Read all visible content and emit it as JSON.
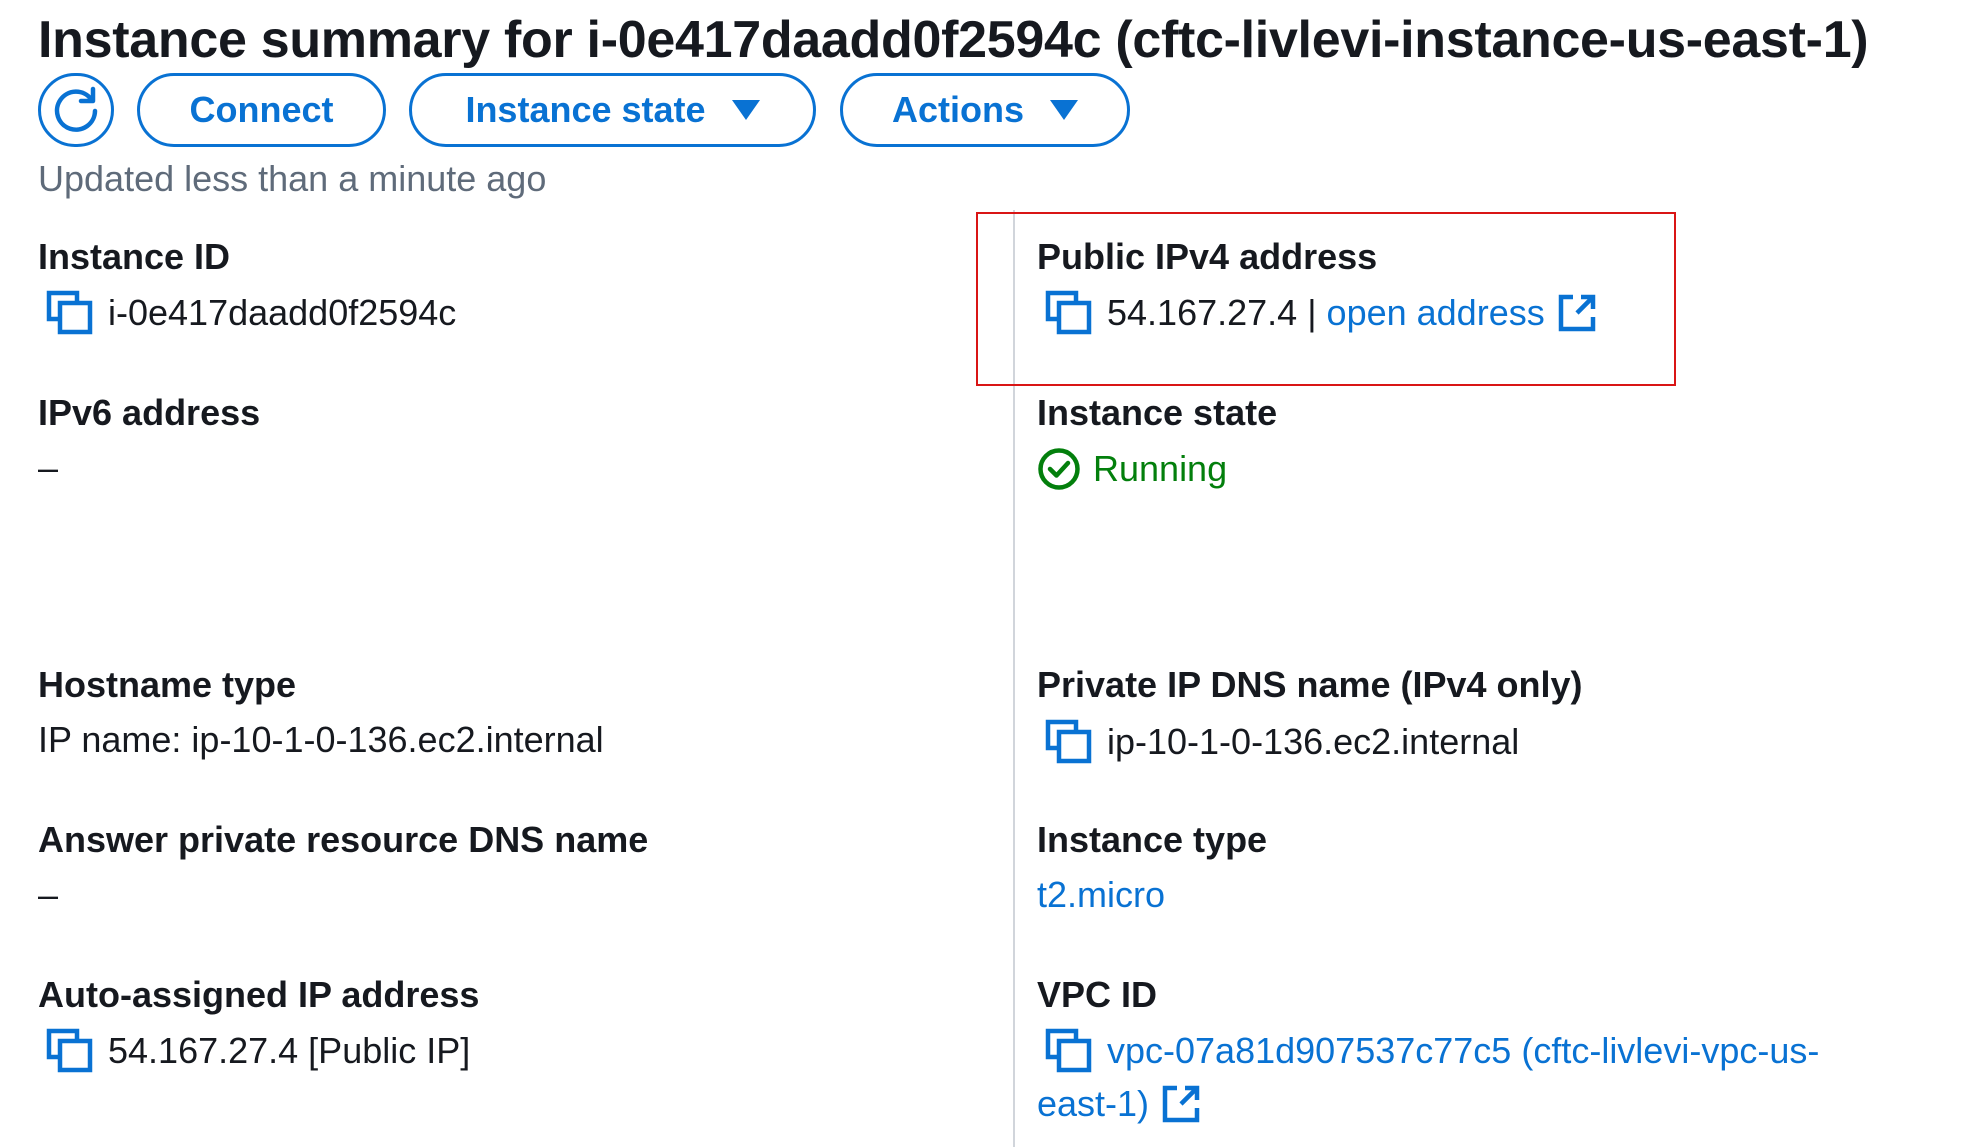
{
  "header": {
    "title": "Instance summary for i-0e417daadd0f2594c (cftc-livlevi-instance-us-east-1)",
    "connect_label": "Connect",
    "instance_state_label": "Instance state",
    "actions_label": "Actions",
    "updated_text": "Updated less than a minute ago"
  },
  "left": {
    "instance_id": {
      "label": "Instance ID",
      "value": "i-0e417daadd0f2594c"
    },
    "ipv6": {
      "label": "IPv6 address",
      "value": "–"
    },
    "hostname_type": {
      "label": "Hostname type",
      "value": "IP name: ip-10-1-0-136.ec2.internal"
    },
    "answer_dns": {
      "label": "Answer private resource DNS name",
      "value": "–"
    },
    "auto_ip": {
      "label": "Auto-assigned IP address",
      "value": "54.167.27.4 [Public IP]"
    }
  },
  "right": {
    "public_ipv4": {
      "label": "Public IPv4 address",
      "value": "54.167.27.4",
      "separator": "|",
      "link_label": "open address"
    },
    "instance_state": {
      "label": "Instance state",
      "value": "Running"
    },
    "private_dns": {
      "label": "Private IP DNS name (IPv4 only)",
      "value": "ip-10-1-0-136.ec2.internal"
    },
    "instance_type": {
      "label": "Instance type",
      "value": "t2.micro"
    },
    "vpc_id": {
      "label": "VPC ID",
      "value_line1": "vpc-07a81d907537c77c5 (cftc-livlevi-vpc-us-",
      "value_line2": "east-1)"
    }
  },
  "colors": {
    "accent": "#0972d3",
    "running": "#037f0c",
    "highlight": "#d91515"
  },
  "icons": [
    "refresh-icon",
    "caret-down-icon",
    "copy-icon",
    "external-link-icon",
    "status-check-icon"
  ]
}
